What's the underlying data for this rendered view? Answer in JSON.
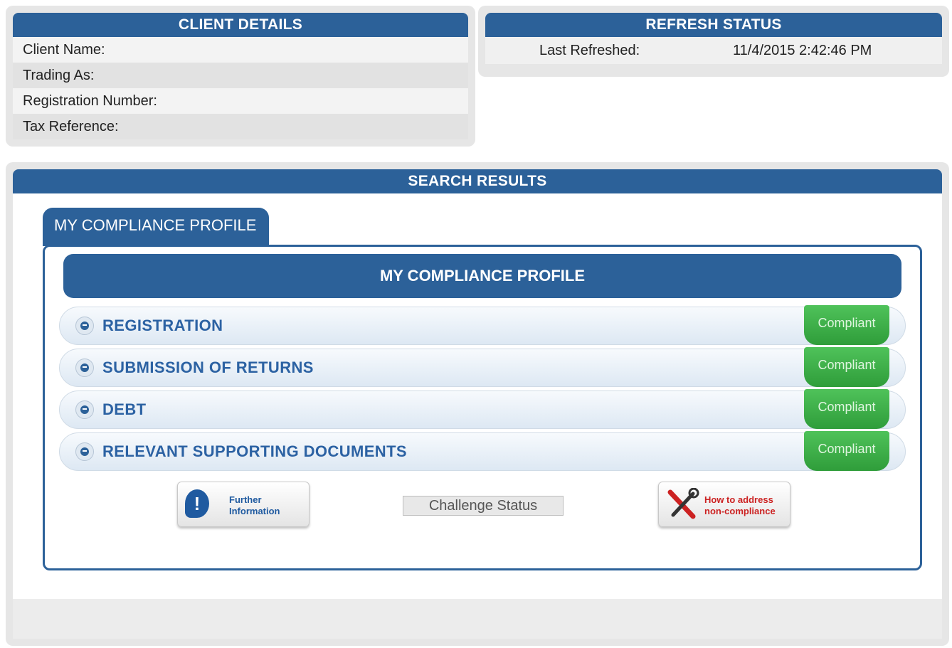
{
  "client_details": {
    "title": "CLIENT DETAILS",
    "rows": [
      {
        "label": "Client Name:"
      },
      {
        "label": "Trading As:"
      },
      {
        "label": "Registration Number:"
      },
      {
        "label": "Tax Reference:"
      }
    ]
  },
  "refresh_status": {
    "title": "REFRESH STATUS",
    "label": "Last Refreshed:",
    "value": "11/4/2015 2:42:46 PM"
  },
  "search_results": {
    "title": "SEARCH RESULTS",
    "tab_label": "MY COMPLIANCE PROFILE",
    "profile_title": "MY COMPLIANCE PROFILE",
    "rows": [
      {
        "label": "REGISTRATION",
        "status": "Compliant"
      },
      {
        "label": "SUBMISSION OF RETURNS",
        "status": "Compliant"
      },
      {
        "label": "DEBT",
        "status": "Compliant"
      },
      {
        "label": "RELEVANT SUPPORTING DOCUMENTS",
        "status": "Compliant"
      }
    ],
    "further_info": {
      "line1": "Further",
      "line2": "Information",
      "icon": "info-bubble-icon"
    },
    "challenge_label": "Challenge Status",
    "address": {
      "line1": "How to address",
      "line2": "non-compliance",
      "icon": "tools-icon"
    }
  },
  "colors": {
    "header_blue": "#2c6199",
    "link_blue": "#2c62a3",
    "compliant_green": "#3aa845",
    "address_red": "#cc2222"
  }
}
